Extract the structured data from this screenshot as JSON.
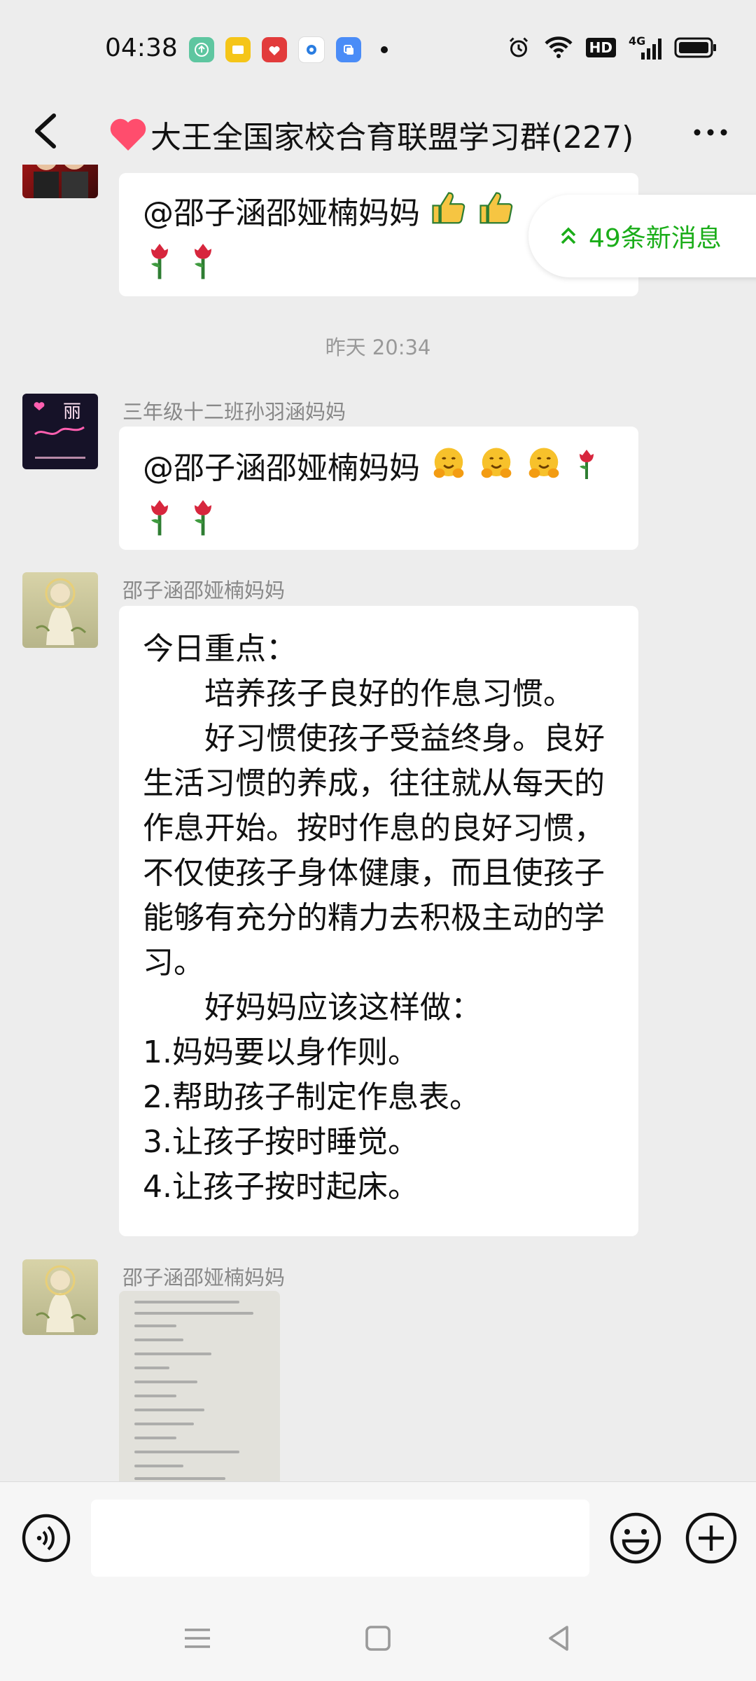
{
  "status_bar": {
    "time": "04:38",
    "network_label": "4G",
    "hd_label": "HD"
  },
  "header": {
    "title": "大王全国家校合育联盟学习群(227)"
  },
  "new_messages": {
    "label": "49条新消息"
  },
  "messages": [
    {
      "text": "@邵子涵邵娅楠妈妈"
    },
    {
      "timestamp": "昨天 20:34"
    },
    {
      "sender": "三年级十二班孙羽涵妈妈",
      "text": "@邵子涵邵娅楠妈妈",
      "avatar_text": "丽"
    },
    {
      "sender": "邵子涵邵娅楠妈妈",
      "lines": [
        "今日重点：",
        "　　培养孩子良好的作息习惯。",
        "　　好习惯使孩子受益终身。良好",
        "生活习惯的养成，往往就从每天的",
        "作息开始。按时作息的良好习惯，",
        "不仅使孩子身体健康，而且使孩子",
        "能够有充分的精力去积极主动的学",
        "习。",
        "　　好妈妈应该这样做：",
        "1.妈妈要以身作则。",
        "2.帮助孩子制定作息表。",
        "3.让孩子按时睡觉。",
        "4.让孩子按时起床。"
      ]
    },
    {
      "sender": "邵子涵邵娅楠妈妈"
    }
  ],
  "input": {
    "placeholder": ""
  },
  "icons": {
    "back": "back-arrow-icon",
    "more": "more-dots-icon",
    "voice": "voice-icon",
    "emoji": "emoji-icon",
    "plus": "plus-icon",
    "heart": "red-heart-icon"
  },
  "colors": {
    "accent_green": "#1aad19",
    "background": "#ededed",
    "bubble": "#ffffff",
    "heart": "#ff4d6d"
  }
}
